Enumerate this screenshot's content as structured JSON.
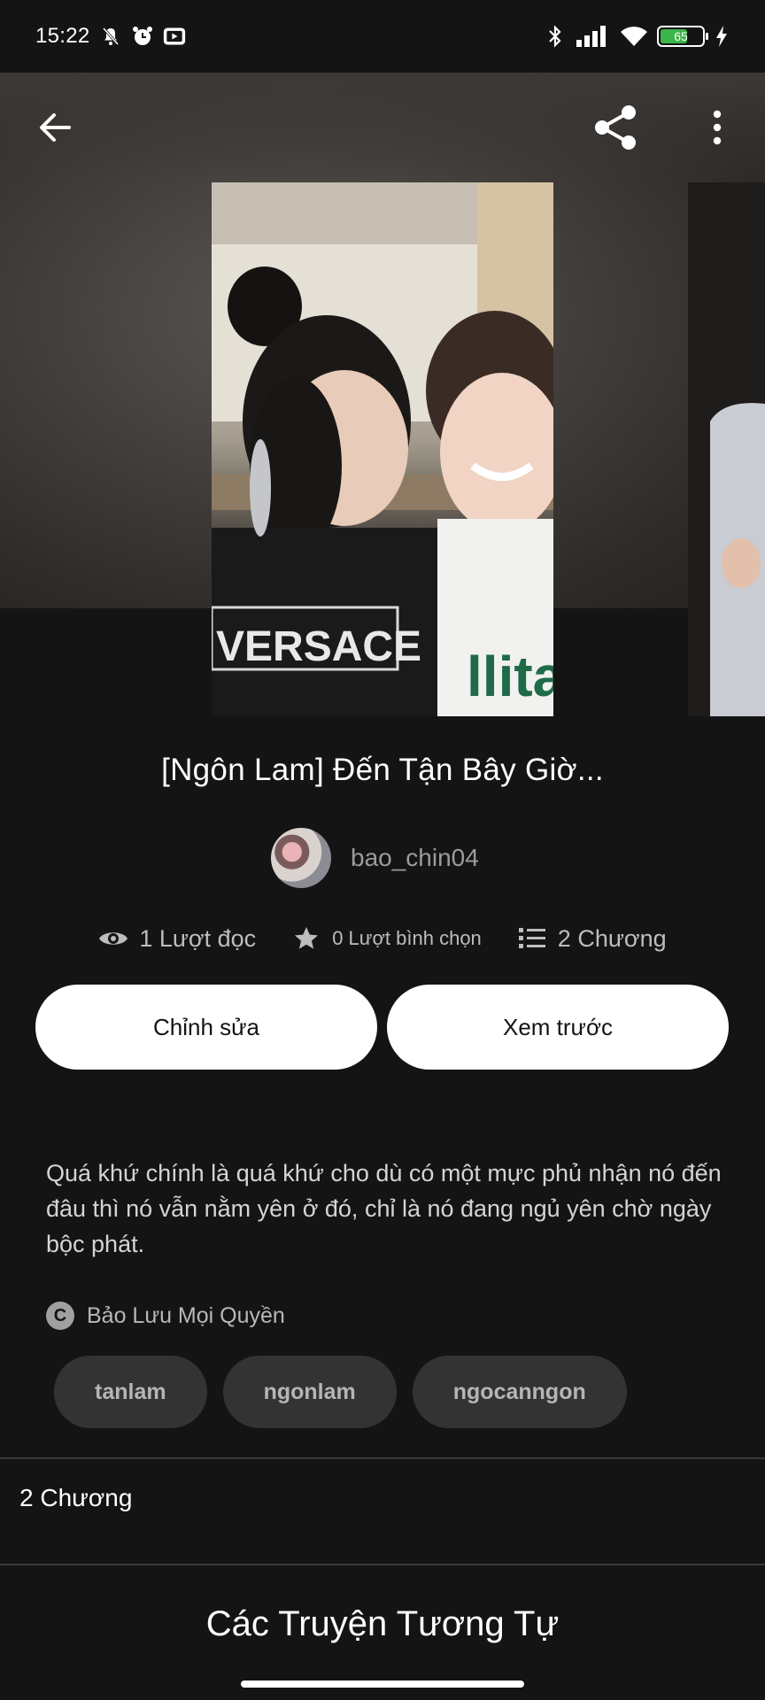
{
  "status_bar": {
    "time": "15:22",
    "battery": "65",
    "battery_level": 0.65,
    "left_icons": [
      "mute-bell-icon",
      "alarm-icon",
      "media-icon"
    ],
    "right_icons": [
      "bluetooth-icon",
      "signal-icon",
      "wifi-icon",
      "battery-icon",
      "charging-icon"
    ]
  },
  "toolbar": {
    "back_icon": "back-arrow-icon",
    "share_icon": "share-icon",
    "more_icon": "more-vertical-icon"
  },
  "story": {
    "title": "[Ngôn Lam] Đến Tận Bây Giờ...",
    "author": "bao_chin04",
    "stats": {
      "reads": "1 Lượt đọc",
      "votes": "0 Lượt bình chọn",
      "chapters": "2 Chương"
    },
    "description": "Quá khứ chính là quá khứ cho dù có một mực phủ nhận nó đến đâu thì nó vẫn nằm yên ở đó, chỉ là nó đang ngủ yên chờ ngày bộc phát.",
    "copyright": "Bảo Lưu Mọi Quyền",
    "tags": [
      "tanlam",
      "ngonlam",
      "ngocanngon"
    ]
  },
  "actions": {
    "edit_label": "Chỉnh sửa",
    "preview_label": "Xem trước"
  },
  "chapters_section": {
    "label": "2 Chương"
  },
  "similar_section": {
    "title": "Các Truyện Tương Tự"
  },
  "colors": {
    "background": "#141414",
    "button_bg": "#ffffff",
    "tag_bg": "#333333",
    "battery_green": "#3bb54a"
  }
}
